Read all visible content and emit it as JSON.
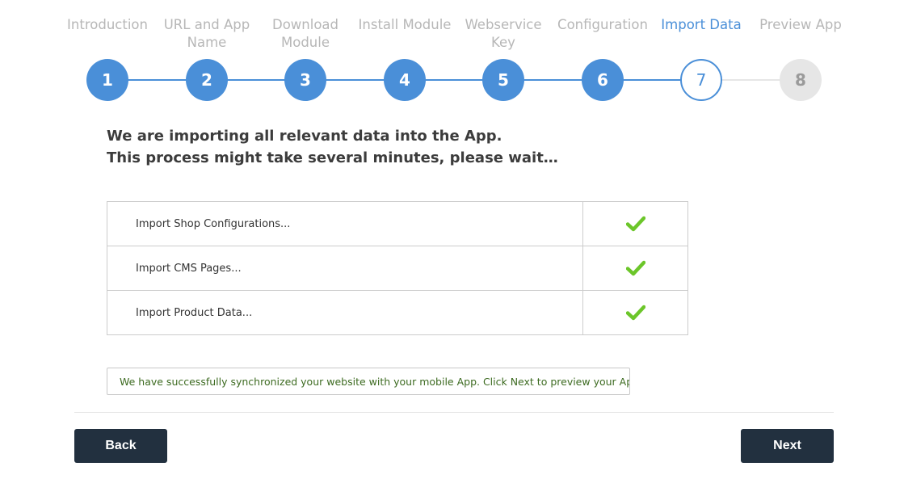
{
  "wizard": {
    "steps": [
      {
        "number": "1",
        "label": "Introduction",
        "state": "done"
      },
      {
        "number": "2",
        "label": "URL and App Name",
        "state": "done"
      },
      {
        "number": "3",
        "label": "Download Module",
        "state": "done"
      },
      {
        "number": "4",
        "label": "Install Module",
        "state": "done"
      },
      {
        "number": "5",
        "label": "Webservice Key",
        "state": "done"
      },
      {
        "number": "6",
        "label": "Configuration",
        "state": "done"
      },
      {
        "number": "7",
        "label": "Import Data",
        "state": "current"
      },
      {
        "number": "8",
        "label": "Preview App",
        "state": "pending"
      }
    ],
    "colors": {
      "accent": "#4a8fd8",
      "inactive_label": "#b7b7b7",
      "pending": "#e6e6e6"
    }
  },
  "intro": {
    "line1": "We are importing all relevant data into the App.",
    "line2": "This process might take several minutes, please wait…"
  },
  "imports": [
    {
      "label": "Import Shop Configurations...",
      "status_icon": "check-icon",
      "status": "complete"
    },
    {
      "label": "Import CMS Pages...",
      "status_icon": "check-icon",
      "status": "complete"
    },
    {
      "label": "Import Product Data...",
      "status_icon": "check-icon",
      "status": "complete"
    }
  ],
  "check_color": "#6cc62a",
  "success_message": "We have successfully synchronized your website with your mobile App. Click Next to preview your App.",
  "buttons": {
    "back": "Back",
    "next": "Next",
    "color": "#22303f"
  }
}
